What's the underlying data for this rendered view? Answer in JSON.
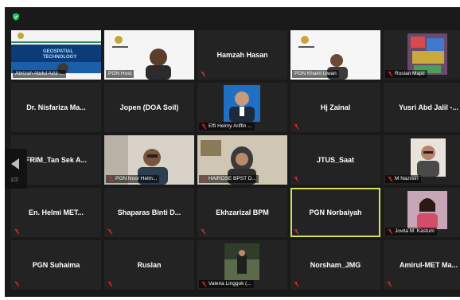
{
  "colors": {
    "background": "#1a1a1a",
    "tile": "#232323",
    "active_border": "#d7e05a",
    "mute_red": "#e02828",
    "shield_green": "#23c45a"
  },
  "pager": {
    "label": "1/2"
  },
  "banner": {
    "line1": "GEOSPATIAL",
    "line2": "TECHNOLOGY"
  },
  "tiles": [
    {
      "name": "Abrizah Abdul Aziz ...",
      "display": "video",
      "muted": false
    },
    {
      "name": "PGN Host",
      "display": "video",
      "muted": false
    },
    {
      "name": "Hamzah Hasan",
      "display": "name",
      "muted": true
    },
    {
      "name": "PGN Khairil Izwan",
      "display": "video",
      "muted": false
    },
    {
      "name": "Roslan Majid",
      "display": "video",
      "muted": true
    },
    {
      "name": "Dr. Nisfariza Ma...",
      "display": "name",
      "muted": false
    },
    {
      "name": "Jopen (DOA Soil)",
      "display": "name",
      "muted": false
    },
    {
      "name": "Effi Helmy Ariffin ...",
      "display": "photo",
      "muted": true
    },
    {
      "name": "Hj Zainal",
      "display": "name",
      "muted": true
    },
    {
      "name": "Yusri Abd Jalil -...",
      "display": "name",
      "muted": false
    },
    {
      "name": "FRIM_Tan Sek A...",
      "display": "name",
      "muted": true
    },
    {
      "name": "PGN Noor Helm...",
      "display": "video",
      "muted": true
    },
    {
      "name": "HAIROSE BPST D...",
      "display": "video",
      "muted": true
    },
    {
      "name": "JTUS_Saat",
      "display": "name",
      "muted": true
    },
    {
      "name": "M Nazrein",
      "display": "photo",
      "muted": true
    },
    {
      "name": "En. Helmi MET...",
      "display": "name",
      "muted": true
    },
    {
      "name": "Shaparas Binti D...",
      "display": "name",
      "muted": true
    },
    {
      "name": "Ekhzarizal BPM",
      "display": "name",
      "muted": true
    },
    {
      "name": "PGN Norbaiyah",
      "display": "name",
      "muted": true,
      "active": true
    },
    {
      "name": "Jovita M. Kastum",
      "display": "photo",
      "muted": true
    },
    {
      "name": "PGN Suhaima",
      "display": "name",
      "muted": true
    },
    {
      "name": "Ruslan",
      "display": "name",
      "muted": true
    },
    {
      "name": "Valeria Linggok (...",
      "display": "photo",
      "muted": true
    },
    {
      "name": "Norsham_JMG",
      "display": "name",
      "muted": true
    },
    {
      "name": "Amirul-MET Ma...",
      "display": "name",
      "muted": true
    }
  ]
}
